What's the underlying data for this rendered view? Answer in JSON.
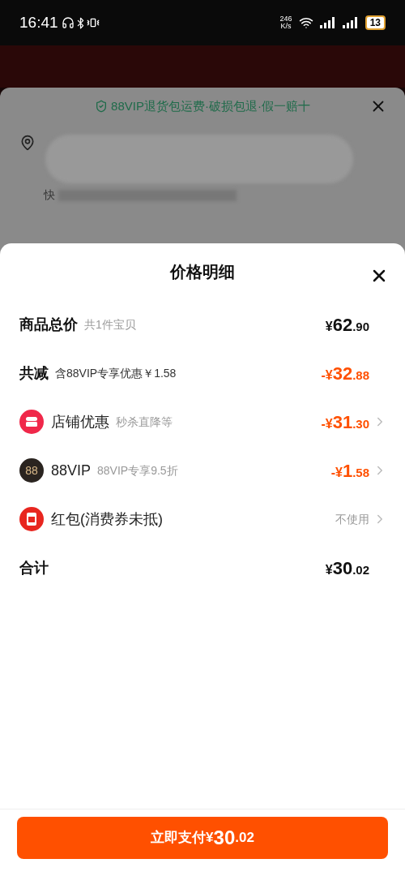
{
  "status_bar": {
    "time": "16:41",
    "speed_value": "246",
    "speed_unit": "K/s",
    "battery": "13"
  },
  "background_sheet": {
    "banner": "88VIP退货包运费·破损包退·假一赔十",
    "address_prefix": "快"
  },
  "price_sheet": {
    "title": "价格明细",
    "rows": [
      {
        "kind": "plain",
        "label": "商品总价",
        "note": "共1件宝贝",
        "discount": false,
        "sign": "",
        "currency": "¥",
        "integer": "62",
        "decimal": ".90",
        "chevron": false
      },
      {
        "kind": "plain",
        "label": "共减",
        "note": "含88VIP专享优惠￥1.58",
        "discount": true,
        "sign": "-",
        "currency": "¥",
        "integer": "32",
        "decimal": ".88",
        "chevron": false
      },
      {
        "kind": "store",
        "label": "店铺优惠",
        "note": "秒杀直降等",
        "discount": true,
        "sign": "-",
        "currency": "¥",
        "integer": "31",
        "decimal": ".30",
        "chevron": true
      },
      {
        "kind": "vip",
        "icon_text": "88",
        "label": "88VIP",
        "note": "88VIP专享9.5折",
        "discount": true,
        "sign": "-",
        "currency": "¥",
        "integer": "1",
        "decimal": ".58",
        "chevron": true
      },
      {
        "kind": "redpacket",
        "label": "红包(消费券未抵)",
        "value_text": "不使用",
        "chevron": true
      },
      {
        "kind": "plain",
        "label": "合计",
        "discount": false,
        "sign": "",
        "currency": "¥",
        "integer": "30",
        "decimal": ".02",
        "chevron": false
      }
    ]
  },
  "pay_button": {
    "label": "立即支付",
    "currency": "¥",
    "integer": "30",
    "decimal": ".02"
  }
}
